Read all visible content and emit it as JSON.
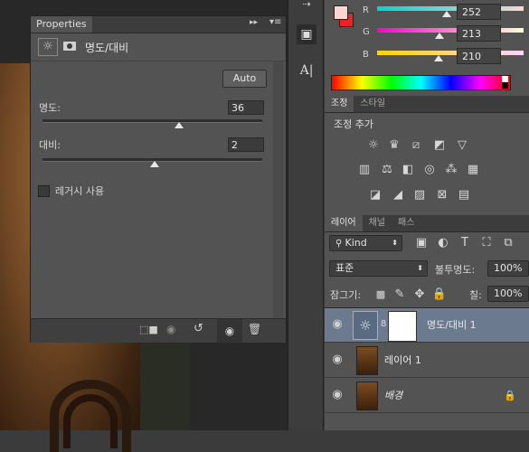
{
  "properties": {
    "tab_label": "Properties",
    "title": "명도/대비",
    "auto_label": "Auto",
    "brightness_label": "명도:",
    "brightness_value": "36",
    "brightness_level": 0.62,
    "contrast_label": "대비:",
    "contrast_value": "2",
    "contrast_level": 0.51,
    "legacy_label": "레거시 사용",
    "legacy_checked": false
  },
  "color": {
    "r_label": "R",
    "r_value": "252",
    "g_label": "G",
    "g_value": "213",
    "b_label": "B",
    "b_value": "210",
    "foreground": "#fcd5d2",
    "background": "#ee2222"
  },
  "adjustments": {
    "tabs": [
      "조정",
      "스타일"
    ],
    "active_tab": 0,
    "heading": "조정 추가"
  },
  "layers": {
    "tabs": [
      "레이어",
      "채널",
      "패스"
    ],
    "filter_kind": "Kind",
    "blend_mode": "표준",
    "opacity_label": "불투명도:",
    "opacity_value": "100%",
    "lock_label": "잠그기:",
    "fill_label": "칠:",
    "fill_value": "100%",
    "items": [
      {
        "name": "명도/대비 1",
        "selected": true
      },
      {
        "name": "레이어 1",
        "selected": false
      },
      {
        "name": "배경",
        "selected": false
      }
    ]
  }
}
